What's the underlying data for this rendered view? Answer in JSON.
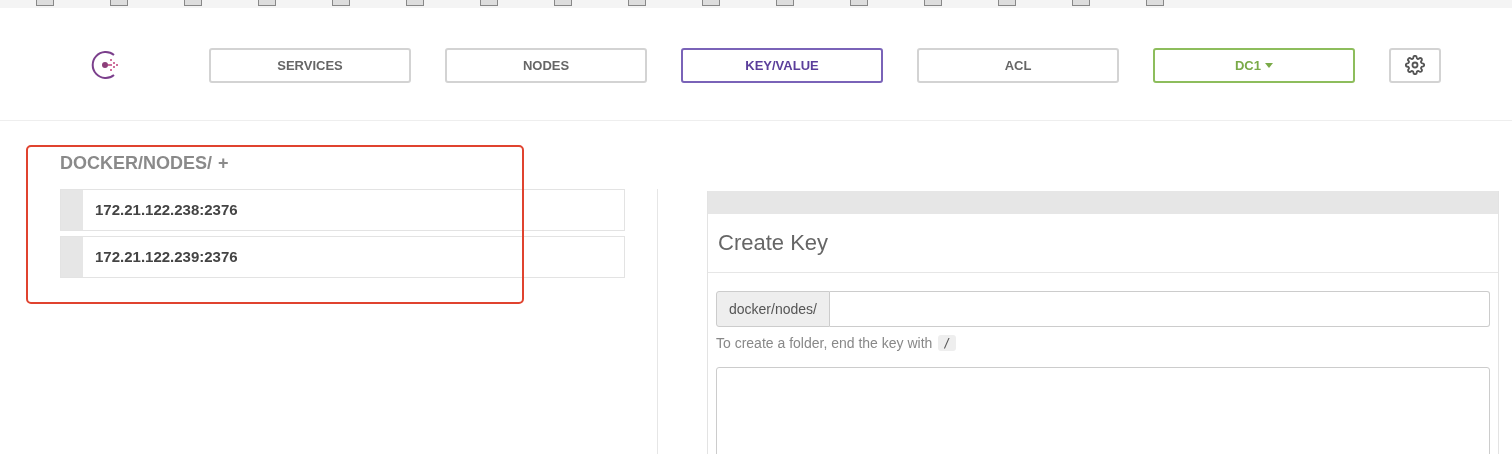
{
  "nav": {
    "items": [
      {
        "label": "SERVICES",
        "kind": "tab",
        "selected": false
      },
      {
        "label": "NODES",
        "kind": "tab",
        "selected": false
      },
      {
        "label": "KEY/VALUE",
        "kind": "tab",
        "selected": true
      },
      {
        "label": "ACL",
        "kind": "tab",
        "selected": false
      },
      {
        "label": "DC1",
        "kind": "dropdown"
      }
    ]
  },
  "breadcrumb": {
    "path": "DOCKER/NODES/",
    "add": "+"
  },
  "keys": [
    {
      "label": "172.21.122.238:2376"
    },
    {
      "label": "172.21.122.239:2376"
    }
  ],
  "create_key": {
    "title": "Create Key",
    "prefix": "docker/nodes/",
    "help": "To create a folder, end the key with",
    "help_code": "/"
  }
}
